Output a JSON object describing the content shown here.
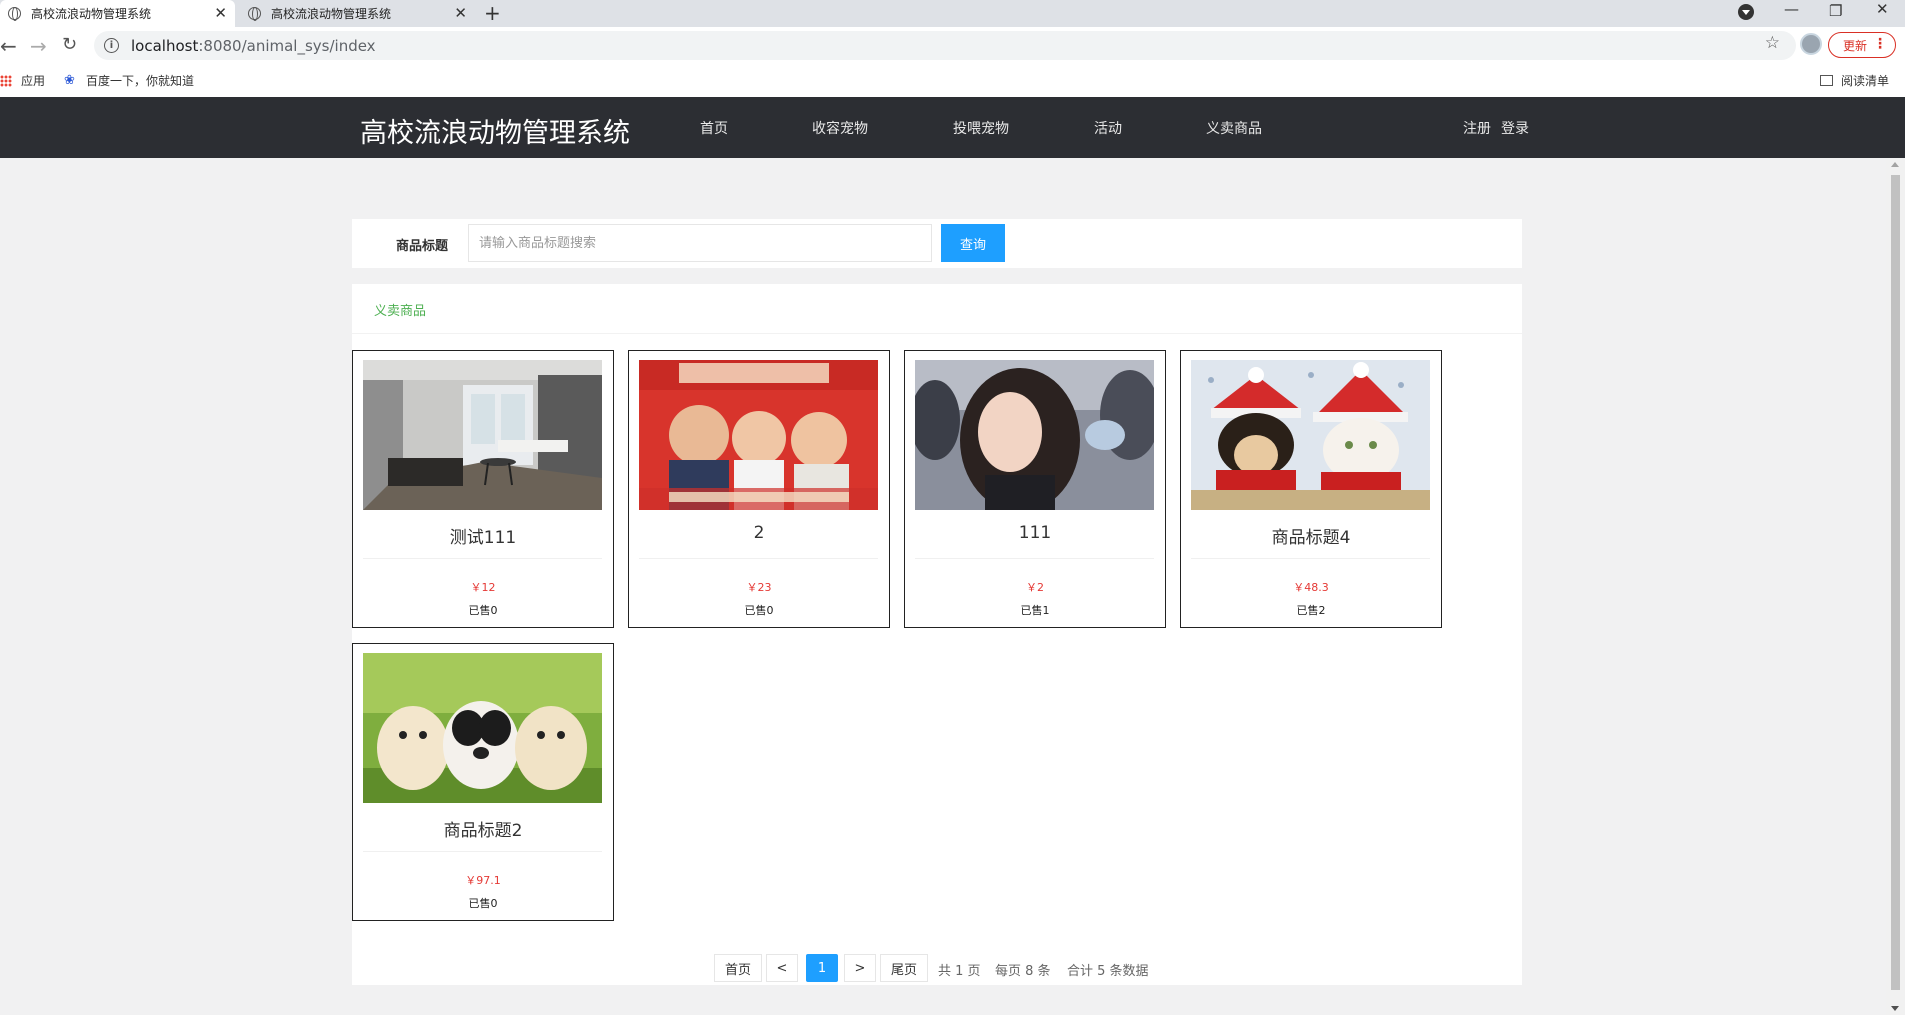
{
  "browser": {
    "tabs": [
      {
        "title": "高校流浪动物管理系统",
        "active": true
      },
      {
        "title": "高校流浪动物管理系统",
        "active": false
      }
    ],
    "url_host": "localhost",
    "url_rest": ":8080/animal_sys/index",
    "update_label": "更新",
    "bookmarks": [
      {
        "label": "应用",
        "icon": "apps-grid-icon"
      },
      {
        "label": "百度一下，你就知道",
        "icon": "baidu-paw-icon"
      }
    ],
    "reading_list": "阅读清单"
  },
  "header": {
    "site_title": "高校流浪动物管理系统",
    "nav": [
      "首页",
      "收容宠物",
      "投喂宠物",
      "活动",
      "义卖商品"
    ],
    "register": "注册",
    "login": "登录"
  },
  "search": {
    "label": "商品标题",
    "placeholder": "请输入商品标题搜索",
    "button": "查询"
  },
  "goods": {
    "section_title": "义卖商品",
    "items": [
      {
        "name": "测试111",
        "price": "￥12",
        "sold": "已售0",
        "image": "room-photo"
      },
      {
        "name": "2",
        "price": "￥23",
        "sold": "已售0",
        "image": "movie-poster"
      },
      {
        "name": "111",
        "price": "￥2",
        "sold": "已售1",
        "image": "portrait-photo"
      },
      {
        "name": "商品标题4",
        "price": "￥48.3",
        "sold": "已售2",
        "image": "christmas-pets-photo"
      },
      {
        "name": "商品标题2",
        "price": "￥97.1",
        "sold": "已售0",
        "image": "puppies-photo"
      }
    ]
  },
  "pagination": {
    "first": "首页",
    "prev": "<",
    "current": "1",
    "next": ">",
    "last": "尾页",
    "total_pages": "共 1 页",
    "per_page": "每页 8 条",
    "total": "合计 5 条数据"
  },
  "colors": {
    "header_bg": "#2c2e33",
    "accent_blue": "#1e9fff",
    "section_green": "#4caf50",
    "price_red": "#e53935"
  }
}
